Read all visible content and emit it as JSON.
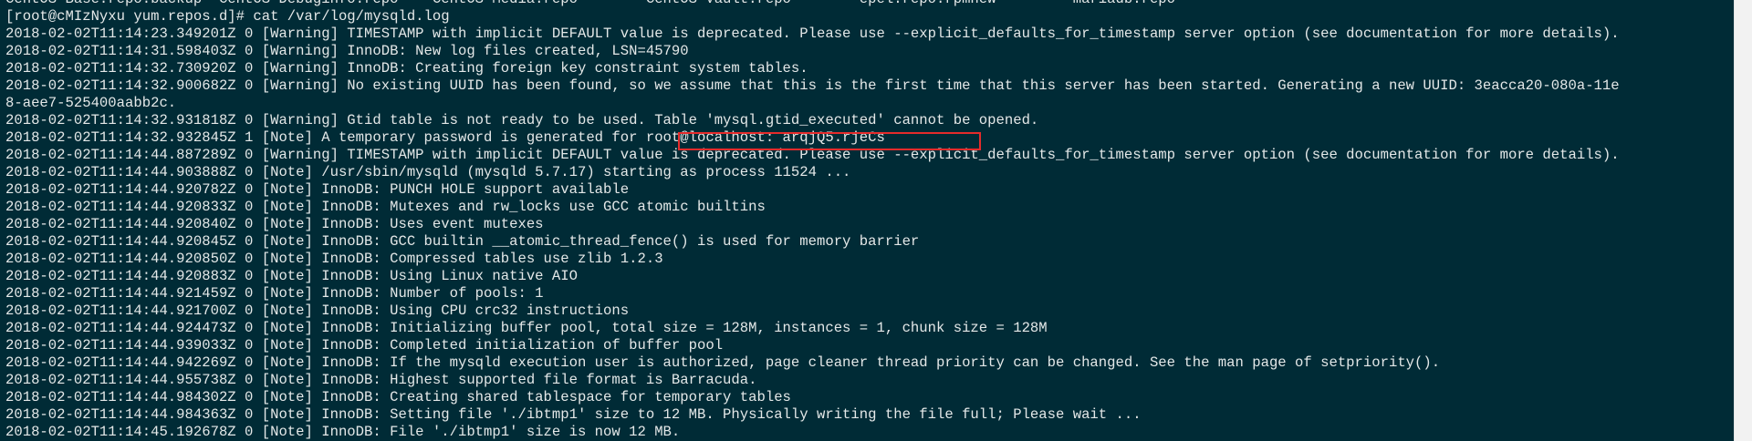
{
  "terminal": {
    "lines": [
      "CentOS-Base.repo.backup  CentOS-Debuginfo.repo    CentOS-Media.repo        CentOS-Vault.repo        epel.repo.rpmnew         mariadb.repo",
      "[root@cMIzNyxu yum.repos.d]# cat /var/log/mysqld.log",
      "2018-02-02T11:14:23.349201Z 0 [Warning] TIMESTAMP with implicit DEFAULT value is deprecated. Please use --explicit_defaults_for_timestamp server option (see documentation for more details).",
      "2018-02-02T11:14:31.598403Z 0 [Warning] InnoDB: New log files created, LSN=45790",
      "2018-02-02T11:14:32.730920Z 0 [Warning] InnoDB: Creating foreign key constraint system tables.",
      "2018-02-02T11:14:32.900682Z 0 [Warning] No existing UUID has been found, so we assume that this is the first time that this server has been started. Generating a new UUID: 3eacca20-080a-11e",
      "8-aee7-525400aabb2c.",
      "2018-02-02T11:14:32.931818Z 0 [Warning] Gtid table is not ready to be used. Table 'mysql.gtid_executed' cannot be opened.",
      "2018-02-02T11:14:32.932845Z 1 [Note] A temporary password is generated for root@localhost: arqjQ5.rjeCs",
      "2018-02-02T11:14:44.887289Z 0 [Warning] TIMESTAMP with implicit DEFAULT value is deprecated. Please use --explicit_defaults_for_timestamp server option (see documentation for more details).",
      "2018-02-02T11:14:44.903888Z 0 [Note] /usr/sbin/mysqld (mysqld 5.7.17) starting as process 11524 ...",
      "2018-02-02T11:14:44.920782Z 0 [Note] InnoDB: PUNCH HOLE support available",
      "2018-02-02T11:14:44.920833Z 0 [Note] InnoDB: Mutexes and rw_locks use GCC atomic builtins",
      "2018-02-02T11:14:44.920840Z 0 [Note] InnoDB: Uses event mutexes",
      "2018-02-02T11:14:44.920845Z 0 [Note] InnoDB: GCC builtin __atomic_thread_fence() is used for memory barrier",
      "2018-02-02T11:14:44.920850Z 0 [Note] InnoDB: Compressed tables use zlib 1.2.3",
      "2018-02-02T11:14:44.920883Z 0 [Note] InnoDB: Using Linux native AIO",
      "2018-02-02T11:14:44.921459Z 0 [Note] InnoDB: Number of pools: 1",
      "2018-02-02T11:14:44.921700Z 0 [Note] InnoDB: Using CPU crc32 instructions",
      "2018-02-02T11:14:44.924473Z 0 [Note] InnoDB: Initializing buffer pool, total size = 128M, instances = 1, chunk size = 128M",
      "2018-02-02T11:14:44.939033Z 0 [Note] InnoDB: Completed initialization of buffer pool",
      "2018-02-02T11:14:44.942269Z 0 [Note] InnoDB: If the mysqld execution user is authorized, page cleaner thread priority can be changed. See the man page of setpriority().",
      "2018-02-02T11:14:44.955738Z 0 [Note] InnoDB: Highest supported file format is Barracuda.",
      "2018-02-02T11:14:44.984302Z 0 [Note] InnoDB: Creating shared tablespace for temporary tables",
      "2018-02-02T11:14:44.984363Z 0 [Note] InnoDB: Setting file './ibtmp1' size to 12 MB. Physically writing the file full; Please wait ...",
      "2018-02-02T11:14:45.192678Z 0 [Note] InnoDB: File './ibtmp1' size is now 12 MB."
    ],
    "colors": {
      "background": "#002b36",
      "text": "#e4e8e8",
      "highlight_border": "#e52b2b"
    }
  }
}
